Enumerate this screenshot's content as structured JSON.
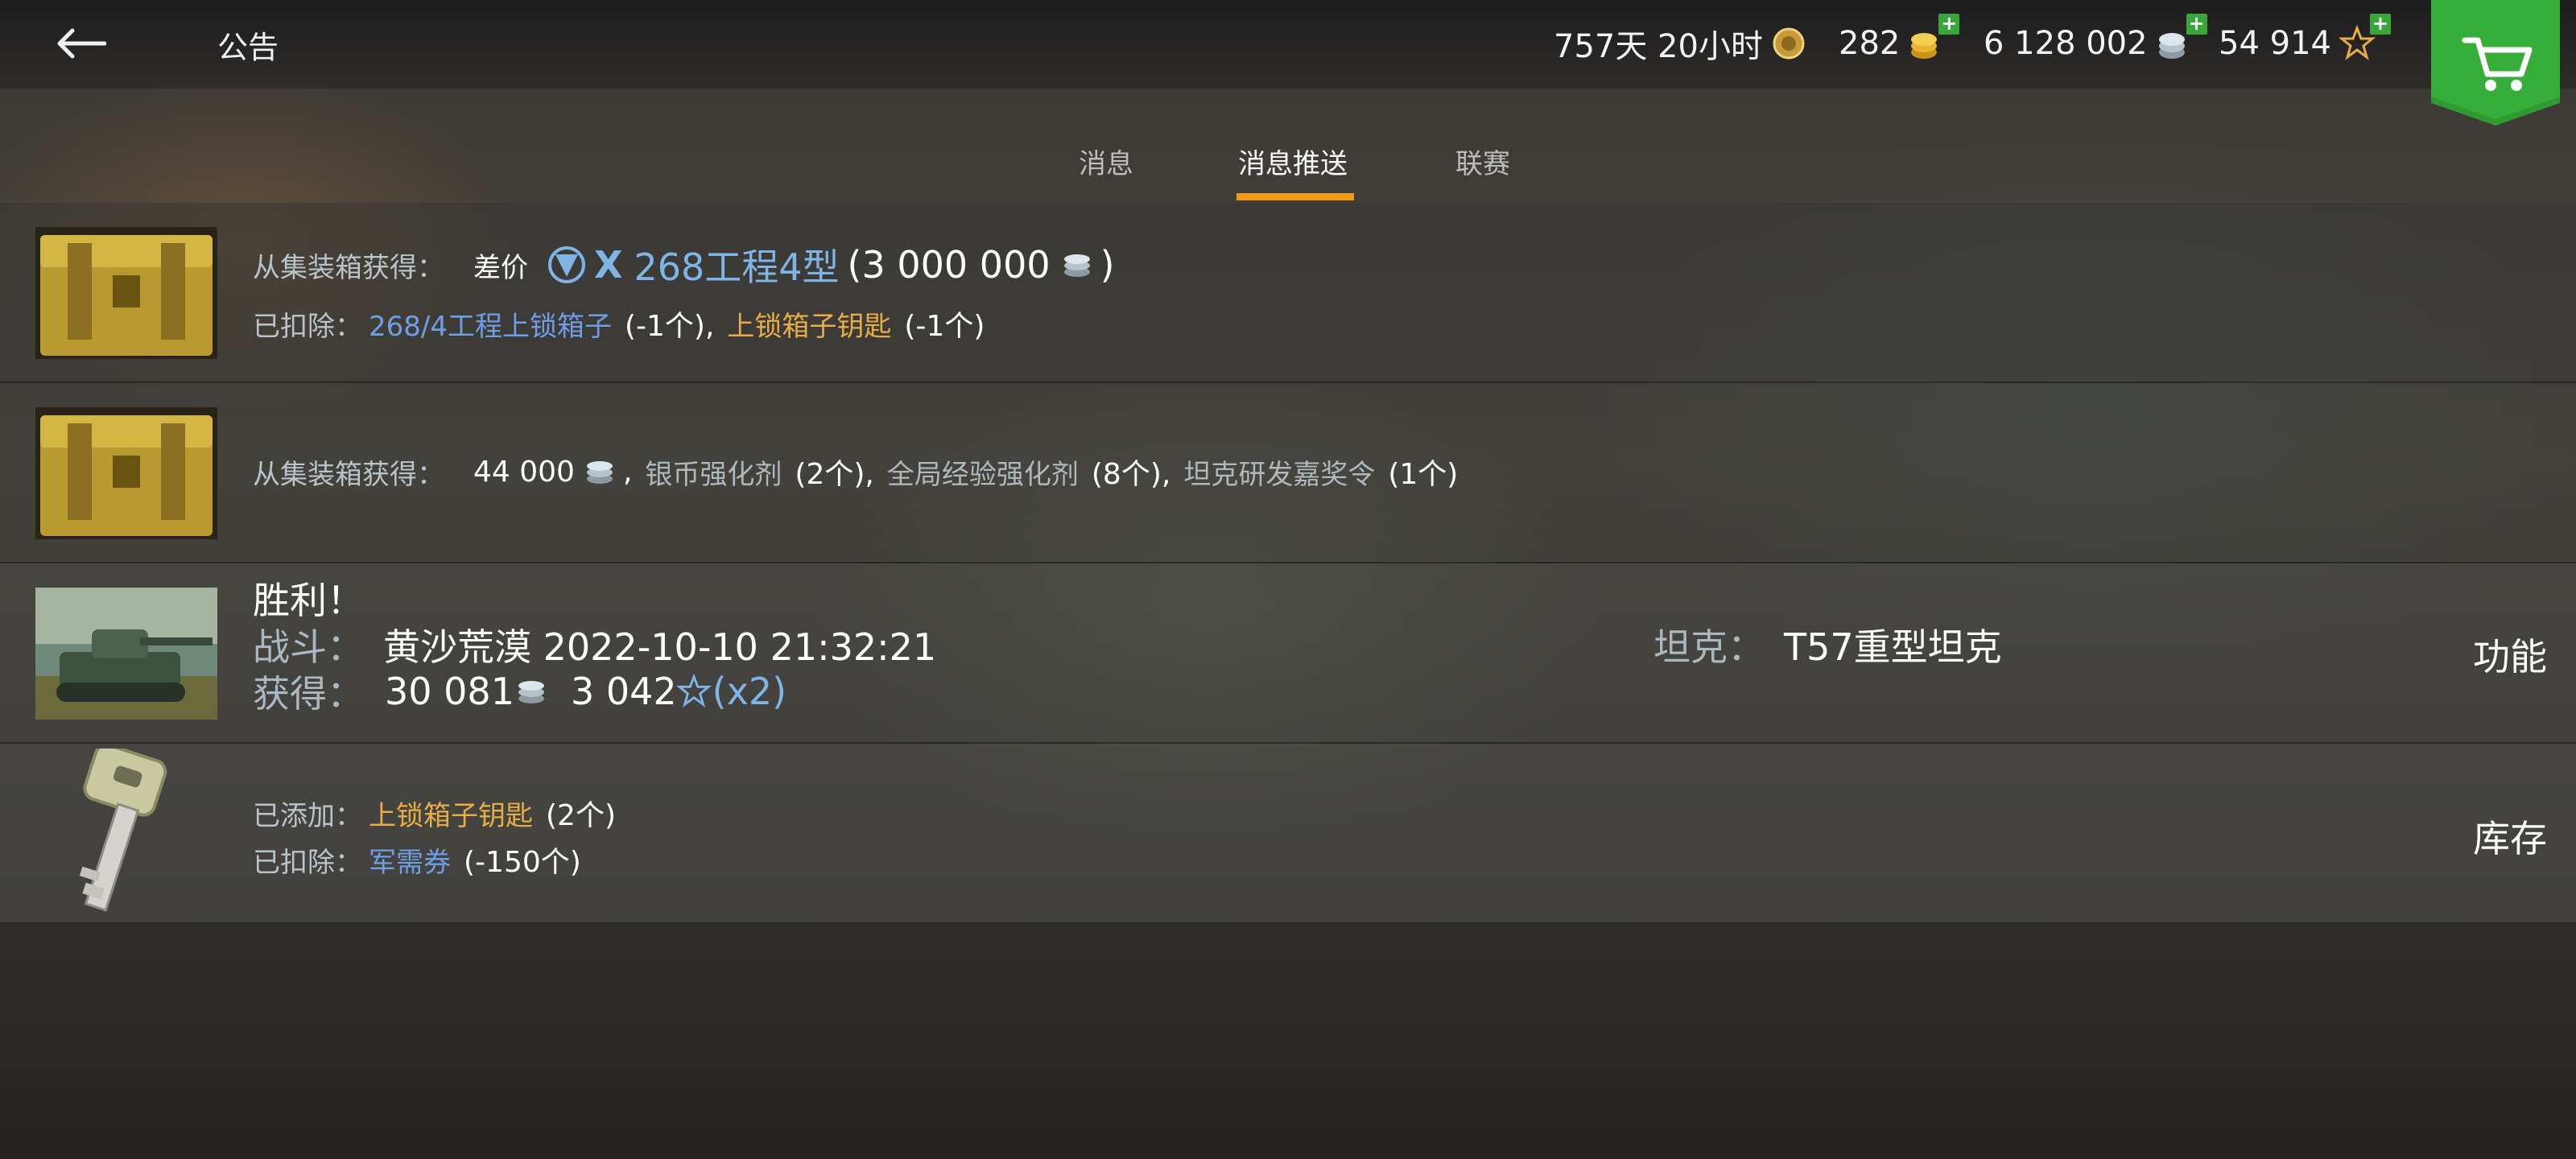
{
  "header": {
    "title": "公告",
    "premium_time": "757天 20小时",
    "gold": "282",
    "credits": "6 128 002",
    "free_xp": "54 914"
  },
  "tabs": [
    {
      "label": "消息",
      "active": false
    },
    {
      "label": "消息推送",
      "active": true
    },
    {
      "label": "联赛",
      "active": false
    }
  ],
  "messages": [
    {
      "line1_label": "从集装箱获得：",
      "line1_prefix": "差价",
      "tier": "X",
      "tank": "268工程4型",
      "amount": "(3 000 000",
      "close_paren": ")",
      "line2_label": "已扣除：",
      "item1": "268/4工程上锁箱子",
      "item1_qty": "(-1个),",
      "item2": "上锁箱子钥匙",
      "item2_qty": "(-1个)"
    },
    {
      "line1_label": "从集装箱获得：",
      "credits": "44 000",
      "sep1": ",",
      "item1": "银币强化剂",
      "item1_qty": "(2个),",
      "item2": "全局经验强化剂",
      "item2_qty": "(8个),",
      "item3": "坦克研发嘉奖令",
      "item3_qty": "(1个)"
    },
    {
      "title": "胜利！",
      "battle_label": "战斗：",
      "battle_value": "黄沙荒漠 2022-10-10 21:32:21",
      "earned_label": "获得：",
      "earned_credits": "30 081",
      "earned_xp": "3 042",
      "xp_mult": "(x2)",
      "tank_label": "坦克：",
      "tank_value": "T57重型坦克",
      "action": "功能"
    },
    {
      "added_label": "已添加：",
      "added_item": "上锁箱子钥匙",
      "added_qty": "(2个)",
      "deducted_label": "已扣除：",
      "deducted_item": "军需券",
      "deducted_qty": "(-150个)",
      "action": "库存"
    }
  ],
  "colors": {
    "accent_tab": "#f19a1a",
    "link_blue": "#6e9fe6",
    "item_gold": "#e7ad46",
    "cart_green": "#2f9a32"
  }
}
